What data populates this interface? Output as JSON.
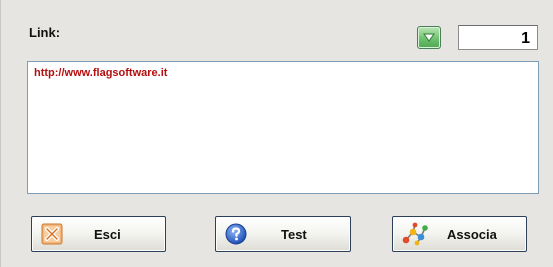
{
  "form": {
    "link_label": "Link:",
    "count_value": "1",
    "link_value": "http://www.flagsoftware.it"
  },
  "buttons": {
    "esci": {
      "label": "Esci",
      "icon": "close-x-icon"
    },
    "test": {
      "label": "Test",
      "icon": "help-question-icon"
    },
    "associa": {
      "label": "Associa",
      "icon": "associate-molecule-icon"
    }
  },
  "icons": {
    "dropdown": "dropdown-arrow-icon"
  },
  "colors": {
    "background": "#e6e5e1",
    "link_text": "#b50e0e",
    "dropdown_green": "#6fc26e",
    "button_border": "#2e3f5a"
  }
}
